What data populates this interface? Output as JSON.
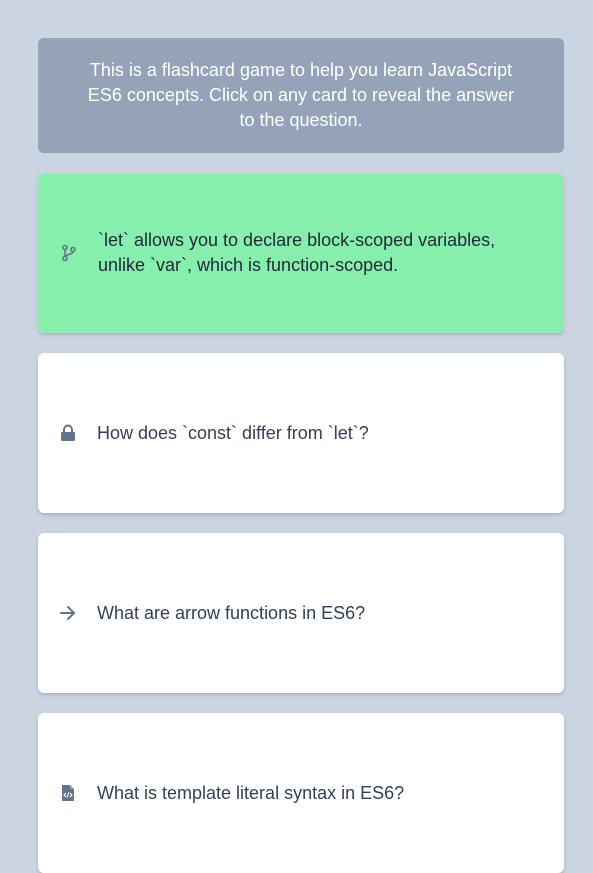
{
  "intro": {
    "text": "This is a flashcard game to help you learn JavaScript ES6 concepts. Click on any card to reveal the answer to the question."
  },
  "cards": [
    {
      "icon": "git-branch-icon",
      "text": "`let` allows you to declare block-scoped variables, unlike `var`, which is function-scoped.",
      "revealed": true
    },
    {
      "icon": "lock-icon",
      "text": "How does `const` differ from `let`?",
      "revealed": false
    },
    {
      "icon": "arrow-right-icon",
      "text": "What are arrow functions in ES6?",
      "revealed": false
    },
    {
      "icon": "code-file-icon",
      "text": "What is template literal syntax in ES6?",
      "revealed": false
    }
  ],
  "colors": {
    "background": "#cbd5e1",
    "intro_bg": "#94a3b8",
    "revealed_card_bg": "#86efac",
    "card_bg": "#ffffff",
    "icon": "#64748b"
  }
}
